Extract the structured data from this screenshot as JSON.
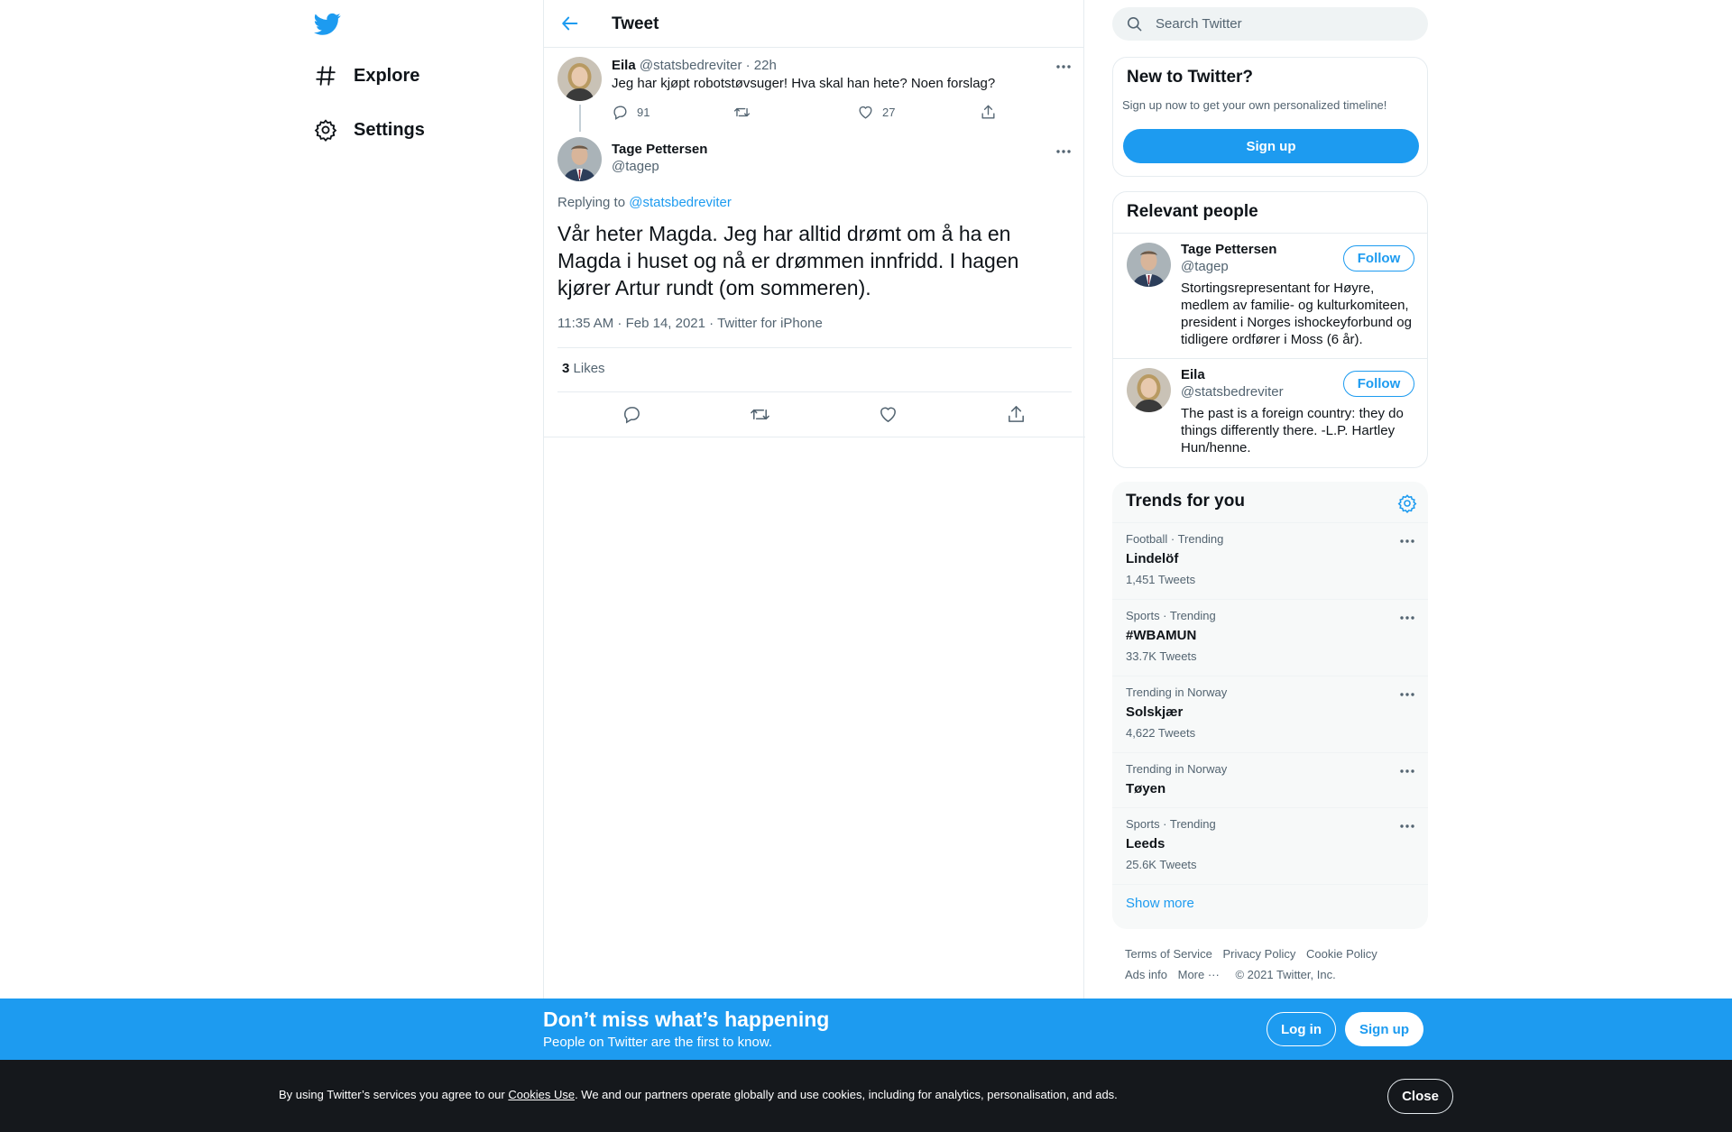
{
  "nav": {
    "items": [
      {
        "label": "Explore",
        "icon": "hashtag-icon"
      },
      {
        "label": "Settings",
        "icon": "gear-icon"
      }
    ]
  },
  "header": {
    "title": "Tweet"
  },
  "reply_tweet": {
    "name": "Eila",
    "handle": "@statsbedreviter",
    "time": "· 22h",
    "text": "Jeg har kjøpt robotstøvsuger! Hva skal han hete? Noen forslag?",
    "replies": "91",
    "likes": "27"
  },
  "main_tweet": {
    "name": "Tage Pettersen",
    "handle": "@tagep",
    "replying_prefix": "Replying to",
    "replying_to": "@statsbedreviter",
    "text": "Vår heter Magda. Jeg har alltid drømt om å ha en Magda i huset og nå er drømmen innfridd. I hagen kjører Artur rundt (om sommeren).",
    "timestamp": "11:35 AM · Feb 14, 2021",
    "source_sep": "·",
    "source": "Twitter for iPhone",
    "likes_count": "3",
    "likes_label": "Likes"
  },
  "sidebar": {
    "search_placeholder": "Search Twitter",
    "new_to_twitter": {
      "title": "New to Twitter?",
      "subtitle": "Sign up now to get your own personalized timeline!",
      "button": "Sign up"
    },
    "relevant_people": {
      "title": "Relevant people",
      "people": [
        {
          "name": "Tage Pettersen",
          "handle": "@tagep",
          "bio": "Stortingsrepresentant for Høyre, medlem av familie- og kulturkomiteen, president i Norges ishockeyforbund og tidligere ordfører i Moss (6 år).",
          "follow": "Follow"
        },
        {
          "name": "Eila",
          "handle": "@statsbedreviter",
          "bio": "The past is a foreign country: they do things differently there. -L.P. Hartley Hun/henne.",
          "follow": "Follow"
        }
      ]
    },
    "trends": {
      "title": "Trends for you",
      "items": [
        {
          "context": "Football · Trending",
          "name": "Lindelöf",
          "count": "1,451 Tweets"
        },
        {
          "context": "Sports · Trending",
          "name": "#WBAMUN",
          "count": "33.7K Tweets"
        },
        {
          "context": "Trending in Norway",
          "name": "Solskjær",
          "count": "4,622 Tweets"
        },
        {
          "context": "Trending in Norway",
          "name": "Tøyen",
          "count": ""
        },
        {
          "context": "Sports · Trending",
          "name": "Leeds",
          "count": "25.6K Tweets"
        }
      ],
      "show_more": "Show more"
    },
    "footer": {
      "links": [
        "Terms of Service",
        "Privacy Policy",
        "Cookie Policy",
        "Ads info",
        "More ···",
        "© 2021 Twitter, Inc."
      ]
    }
  },
  "banner": {
    "title": "Don’t miss what’s happening",
    "subtitle": "People on Twitter are the first to know.",
    "login": "Log in",
    "signup": "Sign up"
  },
  "cookie": {
    "prefix": "By using Twitter’s services you agree to our",
    "link": "Cookies Use",
    "suffix": ". We and our partners operate globally and use cookies, including for analytics, personalisation, and ads.",
    "close": "Close"
  },
  "colors": {
    "accent": "#1d9bf0",
    "text": "#0f1419",
    "muted": "#536471",
    "cookie_bg": "#15181c"
  }
}
